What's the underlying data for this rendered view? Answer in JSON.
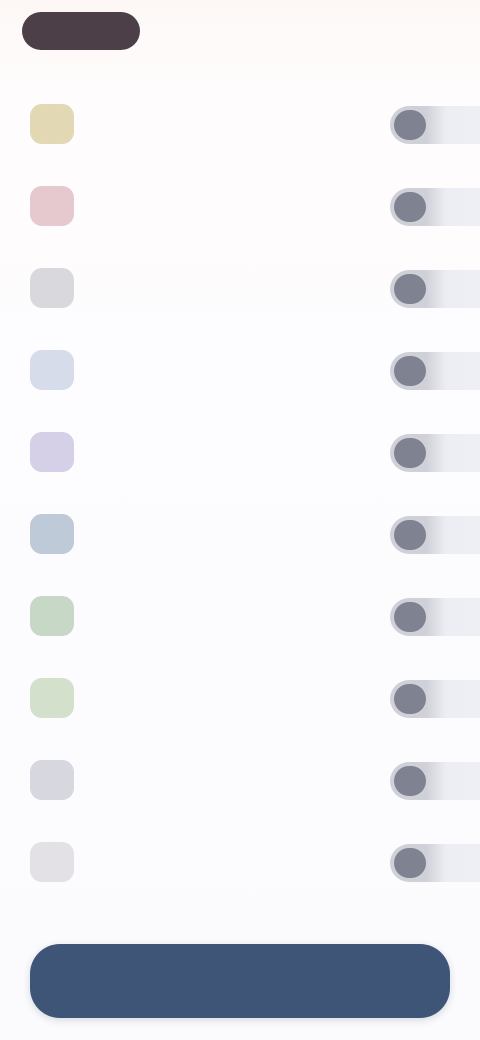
{
  "header": {
    "back_label": "",
    "action_label": ""
  },
  "list": {
    "items": [
      {
        "icon": "yellow-tile-icon",
        "icon_color": "#e3d8b4",
        "label": "",
        "toggle_on": true
      },
      {
        "icon": "pink-tile-icon",
        "icon_color": "#e6c9cf",
        "label": "",
        "toggle_on": true
      },
      {
        "icon": "gray-tile-icon",
        "icon_color": "#d9d8dd",
        "label": "",
        "toggle_on": true
      },
      {
        "icon": "light-blue-tile-icon",
        "icon_color": "#d6dcea",
        "label": "",
        "toggle_on": true
      },
      {
        "icon": "lavender-tile-icon",
        "icon_color": "#d5d0e8",
        "label": "",
        "toggle_on": true
      },
      {
        "icon": "steel-blue-tile-icon",
        "icon_color": "#bfcad8",
        "label": "",
        "toggle_on": true
      },
      {
        "icon": "green-tile-icon",
        "icon_color": "#c7d8c6",
        "label": "",
        "toggle_on": true
      },
      {
        "icon": "light-green-tile-icon",
        "icon_color": "#d3e1cc",
        "label": "",
        "toggle_on": true
      },
      {
        "icon": "gray-blue-tile-icon",
        "icon_color": "#d7d8df",
        "label": "",
        "toggle_on": true
      },
      {
        "icon": "light-gray-tile-icon",
        "icon_color": "#e3e1e6",
        "label": "",
        "toggle_on": true
      }
    ]
  },
  "footer": {
    "primary_label": ""
  },
  "colors": {
    "primary": "#3f5577",
    "back_pill": "#4d3f47",
    "knob": "#7f8290"
  }
}
